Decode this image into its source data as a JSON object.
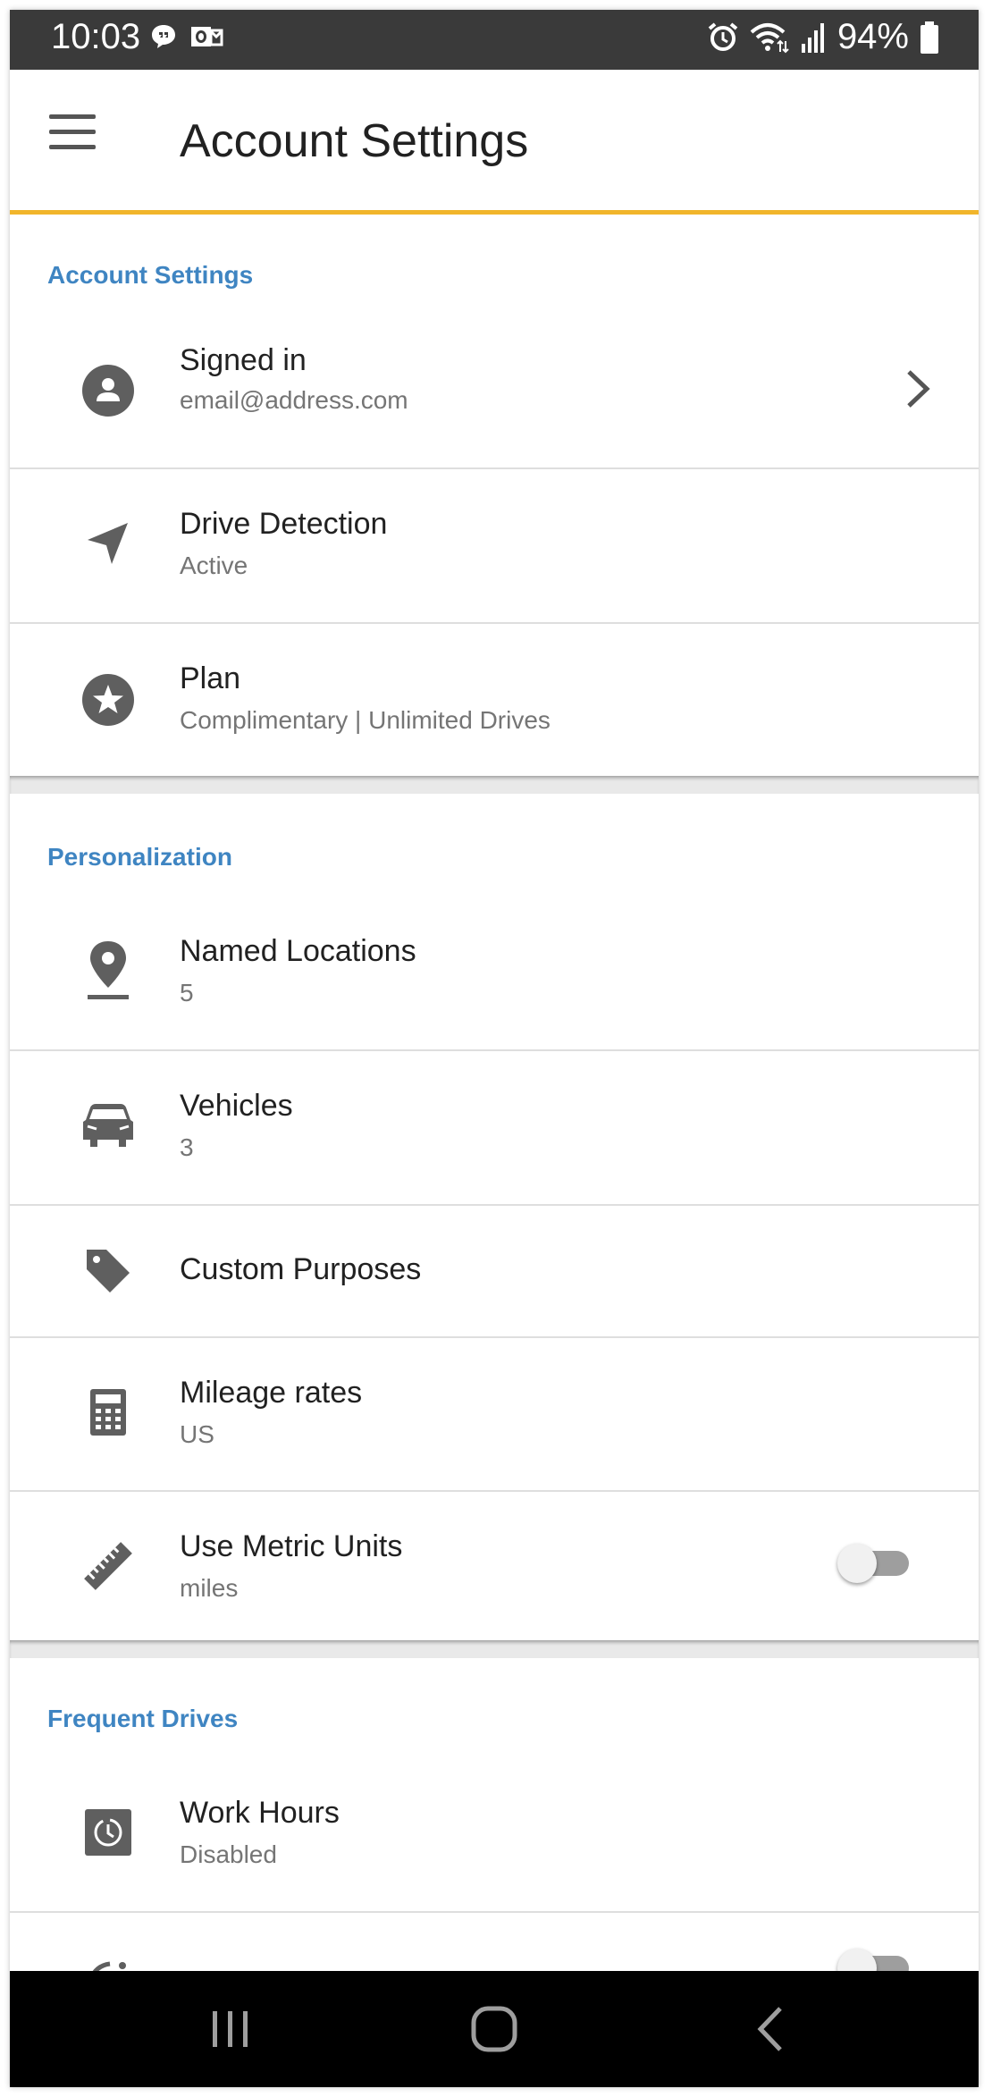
{
  "status_bar": {
    "time": "10:03",
    "battery_percent": "94%",
    "left_icons": [
      "chat-bubble-icon",
      "outlook-icon"
    ],
    "right_icons": [
      "alarm-icon",
      "wifi-icon",
      "signal-icon",
      "battery-icon"
    ]
  },
  "app_bar": {
    "title": "Account Settings",
    "menu_icon": "hamburger-menu-icon",
    "accent_color": "#f1b52b"
  },
  "sections": [
    {
      "header": "Account Settings",
      "rows": [
        {
          "icon": "user-circle-icon",
          "title": "Signed in",
          "subtitle": "email@address.com",
          "trailing": "chevron"
        },
        {
          "icon": "navigation-arrow-icon",
          "title": "Drive Detection",
          "subtitle": "Active"
        },
        {
          "icon": "star-circle-icon",
          "title": "Plan",
          "subtitle": "Complimentary | Unlimited Drives"
        }
      ]
    },
    {
      "header": "Personalization",
      "rows": [
        {
          "icon": "location-pin-icon",
          "title": "Named Locations",
          "subtitle": "5"
        },
        {
          "icon": "car-icon",
          "title": "Vehicles",
          "subtitle": "3"
        },
        {
          "icon": "tag-icon",
          "title": "Custom Purposes"
        },
        {
          "icon": "calculator-icon",
          "title": "Mileage rates",
          "subtitle": "US"
        },
        {
          "icon": "ruler-icon",
          "title": "Use Metric Units",
          "subtitle": "miles",
          "toggle_on": false
        }
      ]
    },
    {
      "header": "Frequent Drives",
      "rows": [
        {
          "icon": "work-hours-clock-icon",
          "title": "Work Hours",
          "subtitle": "Disabled"
        }
      ]
    }
  ],
  "colors": {
    "section_header": "#3f85c2",
    "icon": "#5f5f5f",
    "status_bar": "#3a3a3a"
  },
  "nav_bar": {
    "icons": [
      "recent-apps-icon",
      "home-icon",
      "back-icon"
    ]
  }
}
